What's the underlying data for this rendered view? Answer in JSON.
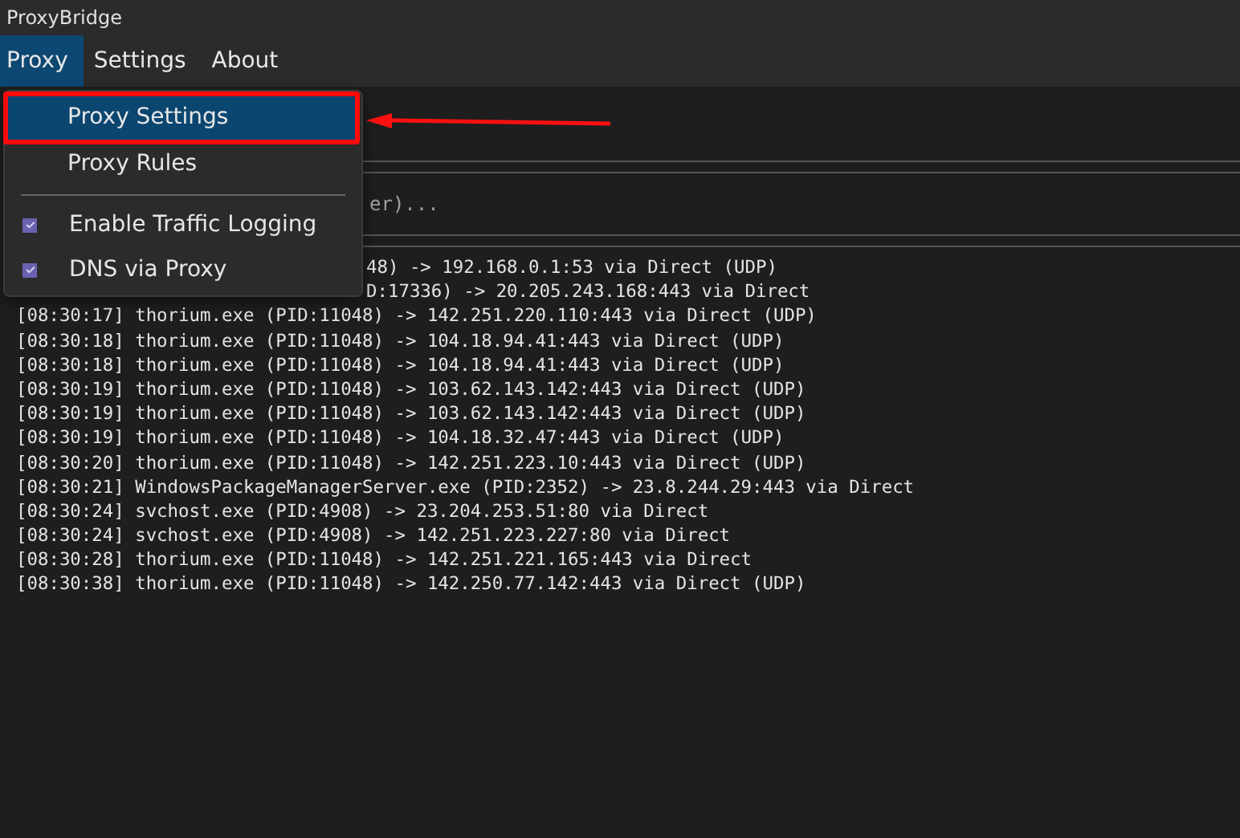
{
  "window": {
    "title": "ProxyBridge"
  },
  "menubar": [
    {
      "label": "Proxy",
      "selected": true
    },
    {
      "label": "Settings",
      "selected": false
    },
    {
      "label": "About",
      "selected": false
    }
  ],
  "filter": {
    "placeholder": "er)..."
  },
  "log": [
    {
      "kind": "covered",
      "text": "48) -> 192.168.0.1:53 via Direct (UDP)"
    },
    {
      "kind": "covered",
      "text": "D:17336) -> 20.205.243.168:443 via Direct"
    },
    {
      "kind": "full",
      "text": "[08:30:17] thorium.exe (PID:11048) -> 142.251.220.110:443 via Direct (UDP)"
    },
    {
      "kind": "full",
      "text": "[08:30:18] thorium.exe (PID:11048) -> 104.18.94.41:443 via Direct (UDP)"
    },
    {
      "kind": "full",
      "text": "[08:30:18] thorium.exe (PID:11048) -> 104.18.94.41:443 via Direct (UDP)"
    },
    {
      "kind": "full",
      "text": "[08:30:19] thorium.exe (PID:11048) -> 103.62.143.142:443 via Direct (UDP)"
    },
    {
      "kind": "full",
      "text": "[08:30:19] thorium.exe (PID:11048) -> 103.62.143.142:443 via Direct (UDP)"
    },
    {
      "kind": "full",
      "text": "[08:30:19] thorium.exe (PID:11048) -> 104.18.32.47:443 via Direct (UDP)"
    },
    {
      "kind": "full",
      "text": "[08:30:20] thorium.exe (PID:11048) -> 142.251.223.10:443 via Direct (UDP)"
    },
    {
      "kind": "full",
      "text": "[08:30:21] WindowsPackageManagerServer.exe (PID:2352) -> 23.8.244.29:443 via Direct"
    },
    {
      "kind": "full",
      "text": "[08:30:24] svchost.exe (PID:4908) -> 23.204.253.51:80 via Direct"
    },
    {
      "kind": "full",
      "text": "[08:30:24] svchost.exe (PID:4908) -> 142.251.223.227:80 via Direct"
    },
    {
      "kind": "full",
      "text": "[08:30:28] thorium.exe (PID:11048) -> 142.251.221.165:443 via Direct"
    },
    {
      "kind": "full",
      "text": "[08:30:38] thorium.exe (PID:11048) -> 142.250.77.142:443 via Direct (UDP)"
    }
  ],
  "menu": [
    {
      "kind": "item",
      "label": "Proxy Settings",
      "selected": true
    },
    {
      "kind": "item",
      "label": "Proxy Rules",
      "selected": false
    },
    {
      "kind": "separator"
    },
    {
      "kind": "check",
      "label": "Enable Traffic Logging",
      "checked": true
    },
    {
      "kind": "check",
      "label": "DNS via Proxy",
      "checked": true
    }
  ]
}
